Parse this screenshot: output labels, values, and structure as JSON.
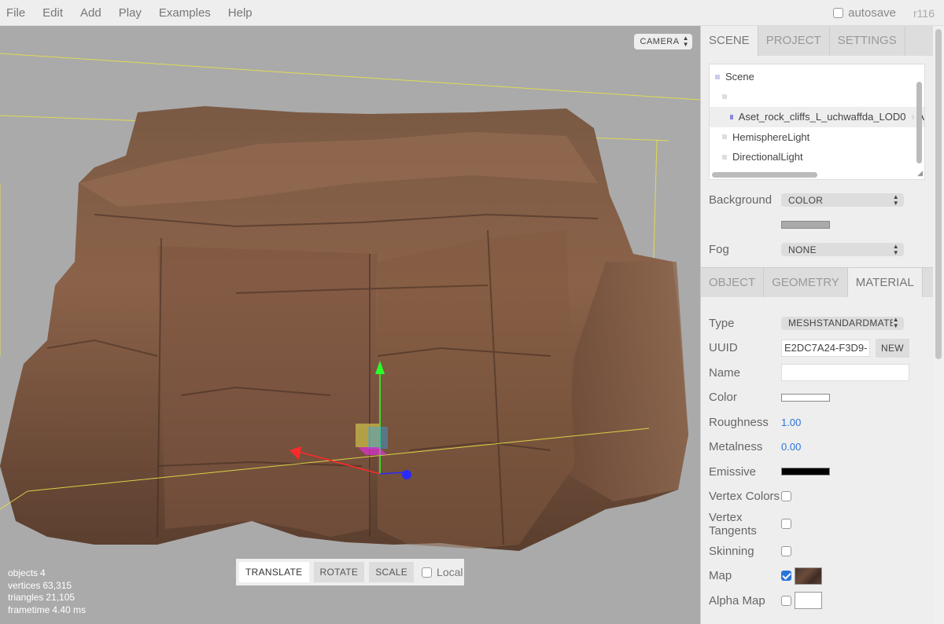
{
  "menubar": {
    "items": [
      "File",
      "Edit",
      "Add",
      "Play",
      "Examples",
      "Help"
    ],
    "autosave_label": "autosave",
    "version": "r116"
  },
  "viewport": {
    "camera_select": "CAMERA",
    "info": {
      "objects_label": "objects",
      "objects_value": "4",
      "vertices_label": "vertices",
      "vertices_value": "63,315",
      "triangles_label": "triangles",
      "triangles_value": "21,105",
      "frametime_label": "frametime",
      "frametime_value": "4.40 ms"
    },
    "toolbar": {
      "translate": "TRANSLATE",
      "rotate": "ROTATE",
      "scale": "SCALE",
      "local": "Local"
    },
    "gizmo_colors": {
      "x": "#ff2a2a",
      "y": "#2aff2a",
      "z": "#2a2aff"
    }
  },
  "sidebar": {
    "main_tabs": [
      "SCENE",
      "PROJECT",
      "SETTINGS"
    ],
    "outliner": {
      "items": [
        "Scene",
        "",
        "Aset_rock_cliffs_L_uchwaffda_LOD0",
        "HemisphereLight",
        "DirectionalLight"
      ],
      "selected_suffix": "A"
    },
    "background": {
      "label": "Background",
      "value": "COLOR",
      "color": "#aaaaaa"
    },
    "fog": {
      "label": "Fog",
      "value": "NONE"
    },
    "properties_tabs": [
      "OBJECT",
      "GEOMETRY",
      "MATERIAL"
    ],
    "material": {
      "type_label": "Type",
      "type_value": "MESHSTANDARDMATE",
      "uuid_label": "UUID",
      "uuid_value": "E2DC7A24-F3D9-",
      "new_button": "NEW",
      "name_label": "Name",
      "name_value": "",
      "color_label": "Color",
      "color_value": "#ffffff",
      "roughness_label": "Roughness",
      "roughness_value": "1.00",
      "metalness_label": "Metalness",
      "metalness_value": "0.00",
      "emissive_label": "Emissive",
      "emissive_value": "#000000",
      "vertex_colors_label": "Vertex Colors",
      "vertex_tangents_label_1": "Vertex",
      "vertex_tangents_label_2": "Tangents",
      "skinning_label": "Skinning",
      "map_label": "Map",
      "alpha_map_label": "Alpha Map"
    }
  }
}
